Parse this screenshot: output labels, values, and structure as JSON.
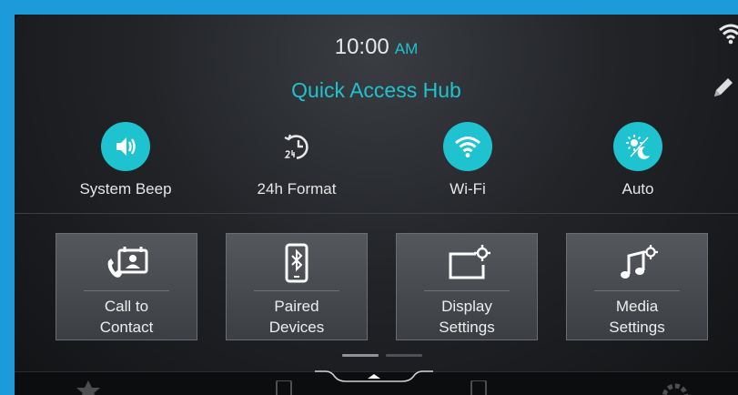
{
  "status": {
    "time": "10:00",
    "ampm": "AM"
  },
  "header": {
    "title": "Quick Access Hub"
  },
  "toggles": [
    {
      "label": "System Beep",
      "icon": "speaker-icon",
      "active": true
    },
    {
      "label": "24h Format",
      "icon": "clock-24-icon",
      "active": false
    },
    {
      "label": "Wi-Fi",
      "icon": "wifi-icon",
      "active": true
    },
    {
      "label": "Auto",
      "icon": "brightness-auto-icon",
      "active": true
    }
  ],
  "tiles": [
    {
      "line1": "Call to",
      "line2": "Contact",
      "icon": "phone-contact-icon"
    },
    {
      "line1": "Paired",
      "line2": "Devices",
      "icon": "bluetooth-phone-icon"
    },
    {
      "line1": "Display",
      "line2": "Settings",
      "icon": "display-settings-icon"
    },
    {
      "line1": "Media",
      "line2": "Settings",
      "icon": "music-settings-icon"
    }
  ],
  "pagination": {
    "pages": 2,
    "current": 1
  },
  "dock": {
    "icons": [
      "star-icon",
      "bluetooth-phone-icon",
      "usb-phone-icon",
      "gear-icon"
    ]
  },
  "colors": {
    "accent": "#1fc2cf",
    "frame": "#1d9ad9",
    "tile": "#4a4d52"
  }
}
